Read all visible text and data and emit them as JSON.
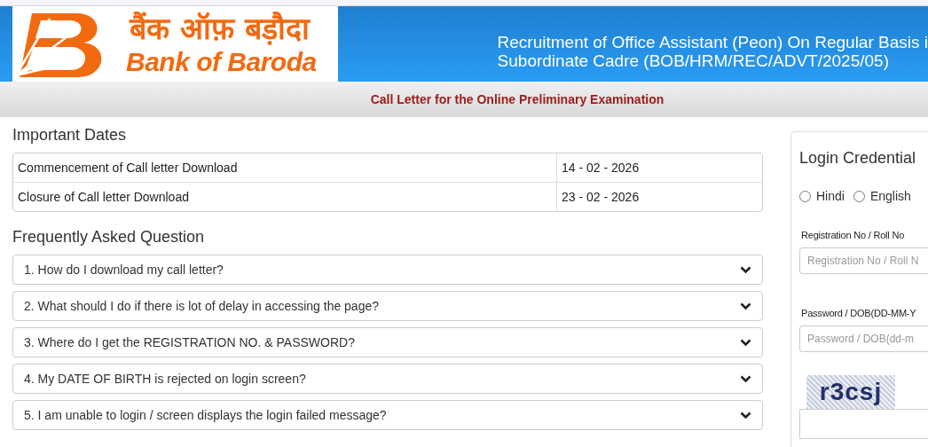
{
  "header": {
    "logo_hindi": "बैंक ऑफ़ बड़ौदा",
    "logo_english": "Bank of Baroda",
    "title_lines": [
      "Recruitment of Office Assistant (Peon) On Regular Basis i",
      "Subordinate Cadre (BOB/HRM/REC/ADVT/2025/05)"
    ]
  },
  "subtitle": "Call Letter for the Online Preliminary Examination",
  "important_dates": {
    "heading": "Important Dates",
    "rows": [
      {
        "label": "Commencement of Call letter Download",
        "date": "14 - 02 - 2026"
      },
      {
        "label": "Closure of Call letter Download",
        "date": "23 - 02 - 2026"
      }
    ]
  },
  "faq": {
    "heading": "Frequently Asked Question",
    "items": [
      {
        "question": "1. How do I download my call letter?",
        "expanded": false
      },
      {
        "question": "2. What should I do if there is lot of delay in accessing the page?",
        "expanded": false
      },
      {
        "question": "3. Where do I get the REGISTRATION NO. & PASSWORD?",
        "expanded": false
      },
      {
        "question": "4. My DATE OF BIRTH is rejected on login screen?",
        "expanded": false
      },
      {
        "question": "5. I am unable to login / screen displays the login failed message?",
        "expanded": false
      }
    ]
  },
  "login": {
    "heading": "Login Credential",
    "languages": [
      {
        "label": "Hindi",
        "selected": false
      },
      {
        "label": "English",
        "selected": false
      }
    ],
    "fields": [
      {
        "label": "Registration No / Roll No",
        "placeholder": "Registration No / Roll N"
      },
      {
        "label": "Password / DOB(DD-MM-Y",
        "placeholder": "Password / DOB(dd-m"
      }
    ],
    "captcha": "r3csj"
  }
}
